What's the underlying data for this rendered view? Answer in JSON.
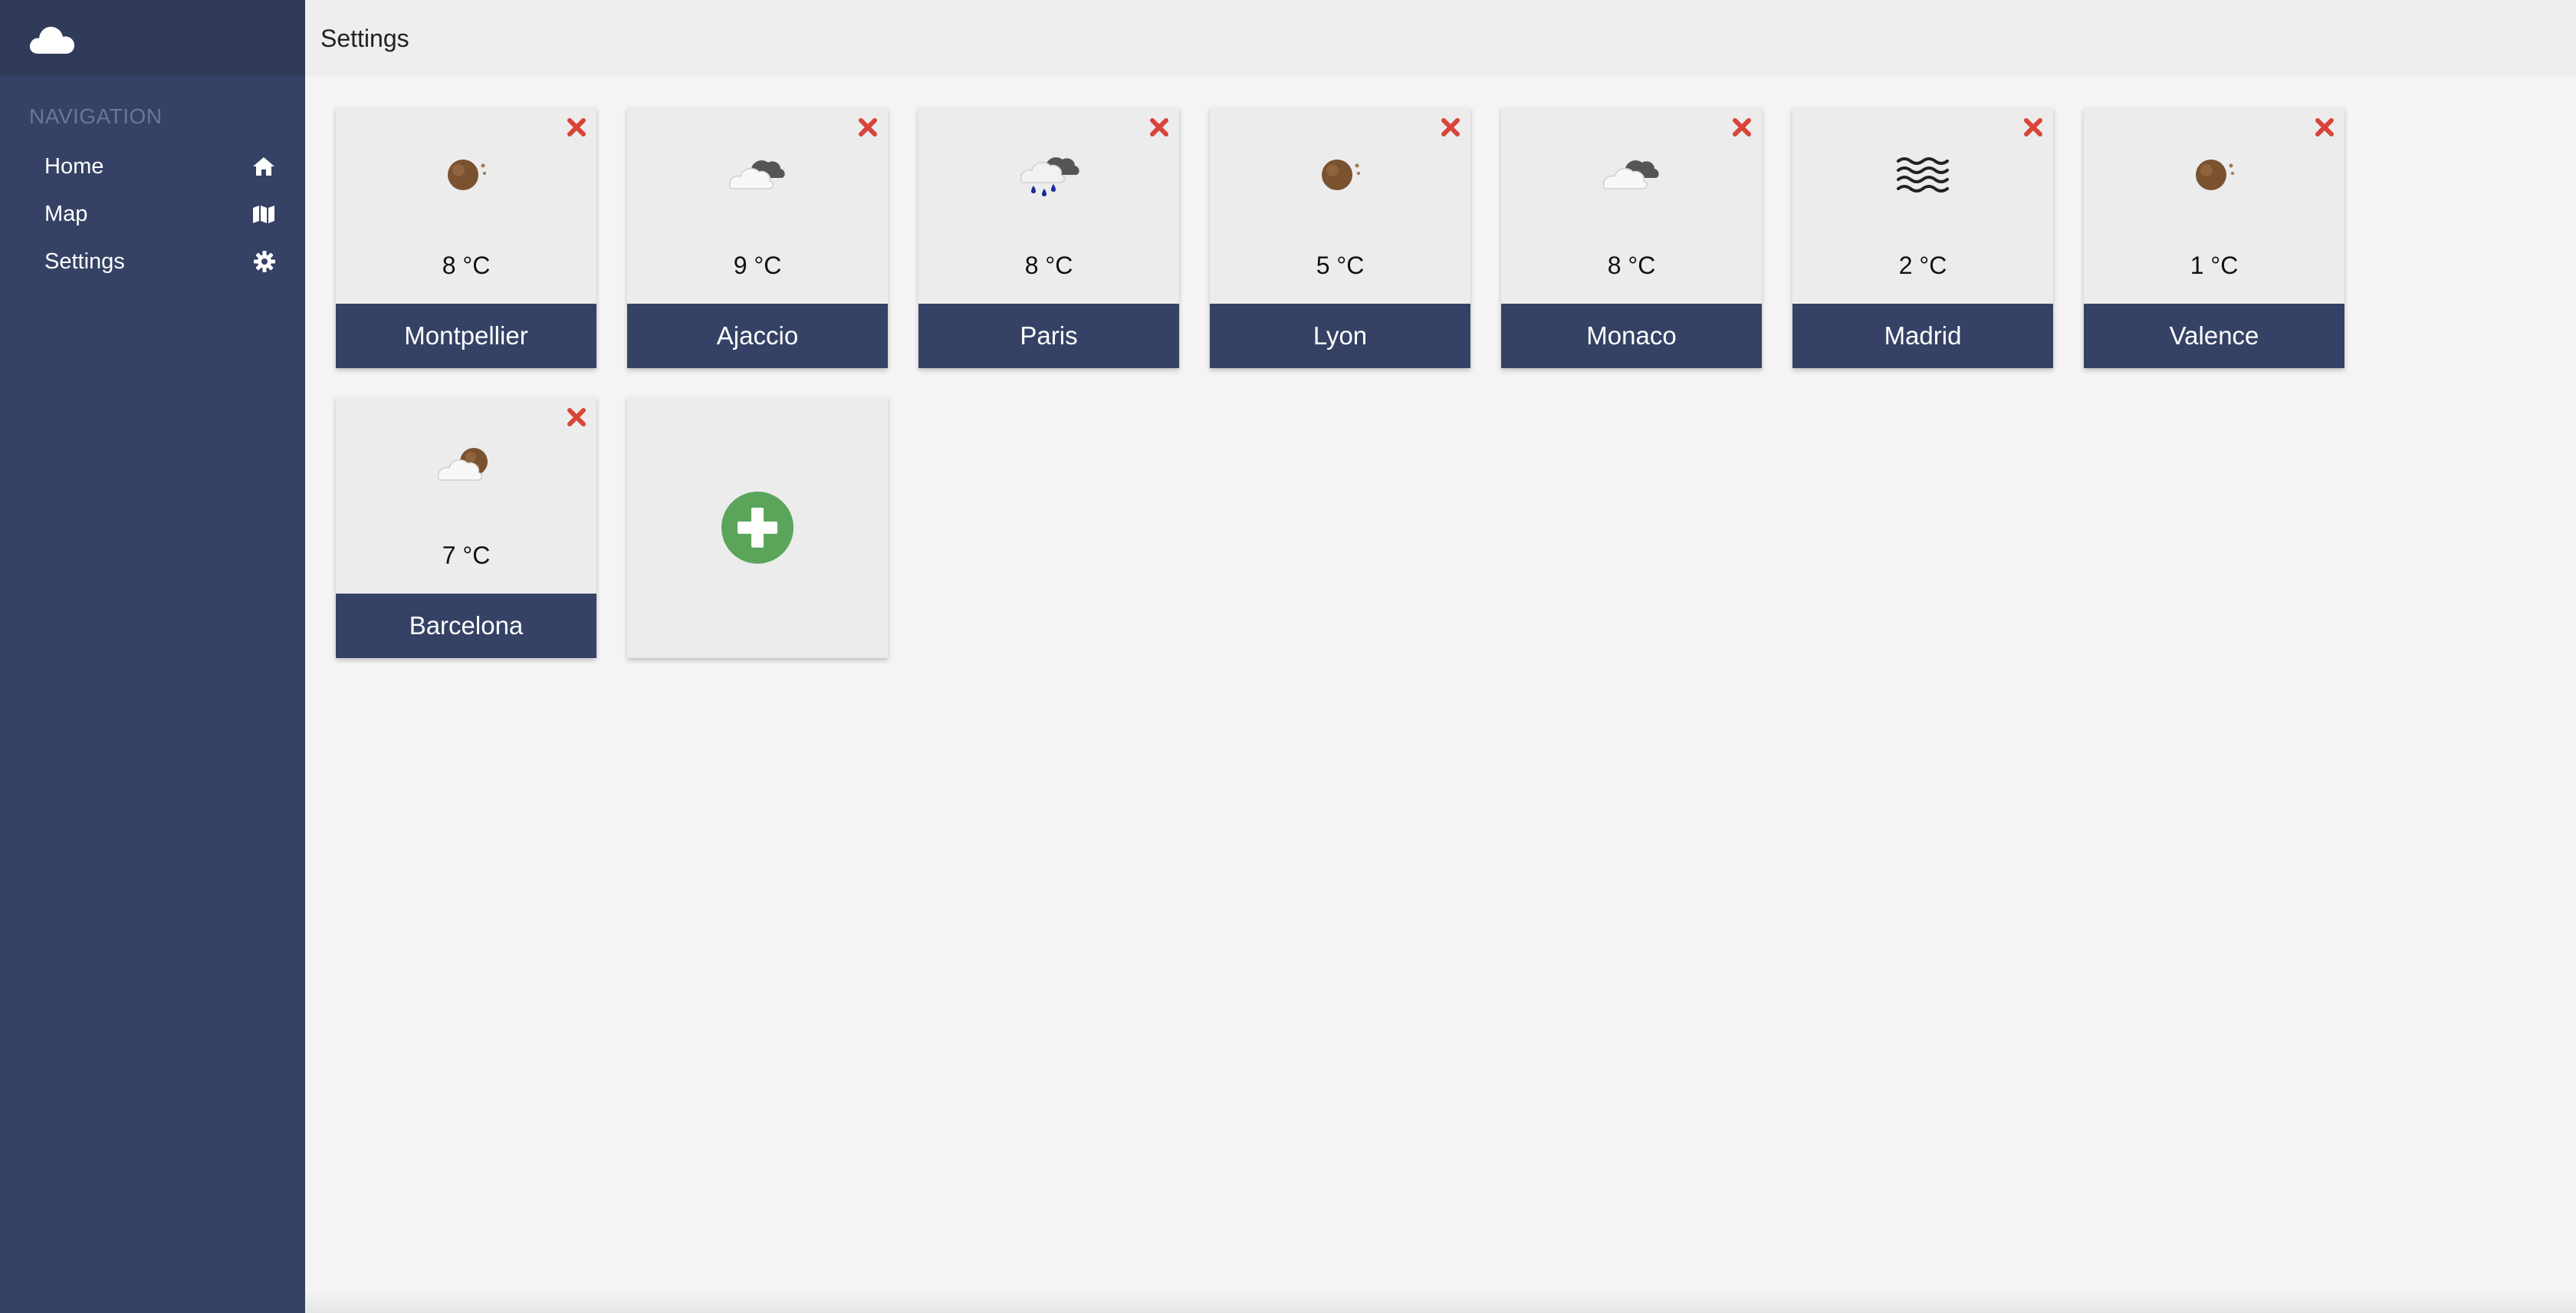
{
  "sidebar": {
    "heading": "NAVIGATION",
    "items": [
      {
        "label": "Home",
        "icon": "home-icon"
      },
      {
        "label": "Map",
        "icon": "map-icon"
      },
      {
        "label": "Settings",
        "icon": "gear-icon"
      }
    ]
  },
  "header": {
    "title": "Settings"
  },
  "cities": [
    {
      "name": "Montpellier",
      "temp": "8 °C",
      "icon": "night-clear-icon"
    },
    {
      "name": "Ajaccio",
      "temp": "9 °C",
      "icon": "cloud-icon"
    },
    {
      "name": "Paris",
      "temp": "8 °C",
      "icon": "rain-cloud-icon"
    },
    {
      "name": "Lyon",
      "temp": "5 °C",
      "icon": "night-clear-icon"
    },
    {
      "name": "Monaco",
      "temp": "8 °C",
      "icon": "cloud-icon"
    },
    {
      "name": "Madrid",
      "temp": "2 °C",
      "icon": "fog-icon"
    },
    {
      "name": "Valence",
      "temp": "1 °C",
      "icon": "night-clear-icon"
    },
    {
      "name": "Barcelona",
      "temp": "7 °C",
      "icon": "night-partly-cloudy-icon"
    }
  ],
  "colors": {
    "sidebar": "#354265",
    "accent_remove": "#d9443a",
    "add_button": "#5aa55a"
  }
}
